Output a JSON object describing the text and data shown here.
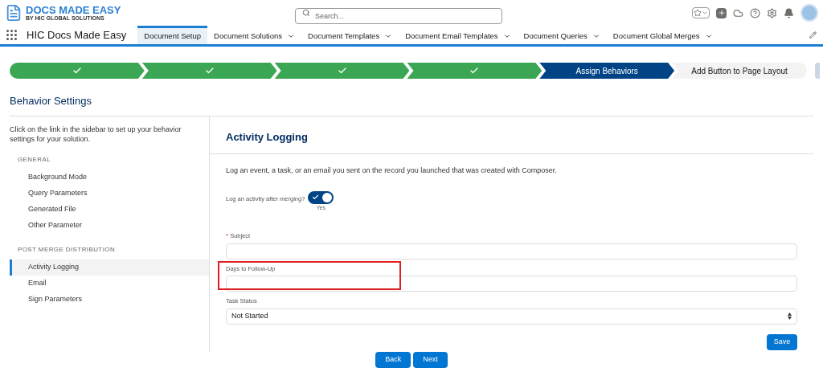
{
  "header": {
    "logo": {
      "title": "DOCS MADE EASY",
      "subtitle": "BY HIC GLOBAL SOLUTIONS"
    },
    "search": {
      "placeholder": "Search..."
    }
  },
  "nav": {
    "app_name": "HIC Docs Made Easy",
    "tabs": [
      {
        "label": "Document Setup",
        "selected": true,
        "dropdown": false
      },
      {
        "label": "Document Solutions",
        "selected": false,
        "dropdown": true
      },
      {
        "label": "Document Templates",
        "selected": false,
        "dropdown": true
      },
      {
        "label": "Document Email Templates",
        "selected": false,
        "dropdown": true
      },
      {
        "label": "Document Queries",
        "selected": false,
        "dropdown": true
      },
      {
        "label": "Document Global Merges",
        "selected": false,
        "dropdown": true
      }
    ]
  },
  "path": [
    {
      "kind": "complete"
    },
    {
      "kind": "complete"
    },
    {
      "kind": "complete"
    },
    {
      "kind": "complete"
    },
    {
      "kind": "current",
      "label": "Assign Behaviors"
    },
    {
      "kind": "upcoming",
      "label": "Add Button to Page Layout"
    }
  ],
  "page_title": "Behavior Settings",
  "sidebar": {
    "intro": "Click on the link in the sidebar to set up your behavior settings for your solution.",
    "sections": [
      {
        "heading": "GENERAL",
        "items": [
          {
            "label": "Background Mode",
            "selected": false
          },
          {
            "label": "Query Parameters",
            "selected": false
          },
          {
            "label": "Generated File",
            "selected": false
          },
          {
            "label": "Other Parameter",
            "selected": false
          }
        ]
      },
      {
        "heading": "POST MERGE DISTRIBUTION",
        "items": [
          {
            "label": "Activity Logging",
            "selected": true
          },
          {
            "label": "Email",
            "selected": false
          },
          {
            "label": "Sign Parameters",
            "selected": false
          }
        ]
      }
    ]
  },
  "panel": {
    "title": "Activity Logging",
    "description": "Log an event, a task, or an email you sent on the record you launched that was created with Composer.",
    "toggle": {
      "label": "Log an activity after merging?",
      "on": true,
      "state_text": "Yes"
    },
    "fields": [
      {
        "kind": "text",
        "label": "Subject",
        "required_mark": "*",
        "highlighted": false
      },
      {
        "kind": "text",
        "label": "Days to Follow-Up",
        "highlighted": true
      },
      {
        "kind": "select",
        "label": "Task Status",
        "highlighted": false,
        "value": "Not Started"
      }
    ],
    "save": "Save"
  },
  "footer_buttons": [
    "Back",
    "Next"
  ]
}
